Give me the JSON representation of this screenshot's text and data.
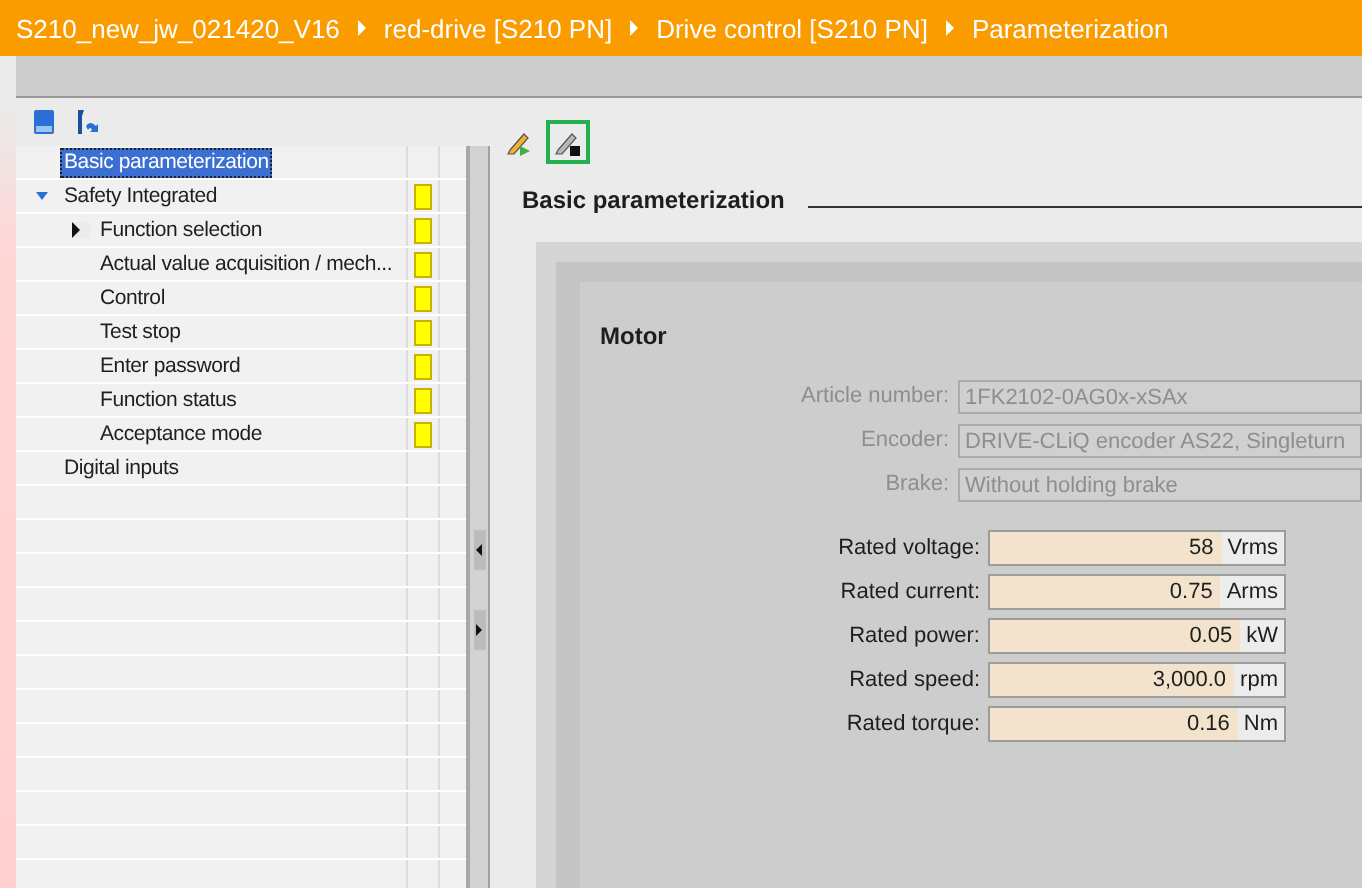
{
  "breadcrumb": [
    "S210_new_jw_021420_V16",
    "red-drive [S210 PN]",
    "Drive control [S210 PN]",
    "Parameterization"
  ],
  "tree": [
    {
      "label": "Basic parameterization",
      "selected": true
    },
    {
      "label": "Safety Integrated",
      "selected": false,
      "expanded": true,
      "color": "#ffff00",
      "children": [
        {
          "label": "Function selection",
          "selected": false,
          "expanded": false,
          "color": "#ffff00"
        },
        {
          "label": "Actual value acquisition / mech...",
          "selected": false,
          "color": "#ffff00"
        },
        {
          "label": "Control",
          "selected": false,
          "color": "#ffff00"
        },
        {
          "label": "Test stop",
          "selected": false,
          "color": "#ffff00"
        },
        {
          "label": "Enter password",
          "selected": false,
          "color": "#ffff00"
        },
        {
          "label": "Function status",
          "selected": false,
          "color": "#ffff00"
        },
        {
          "label": "Acceptance mode",
          "selected": false,
          "color": "#ffff00"
        }
      ]
    },
    {
      "label": "Digital inputs",
      "selected": false
    }
  ],
  "editor_toolbar": [
    {
      "kind": "online",
      "selected": false
    },
    {
      "kind": "offline",
      "selected": true
    }
  ],
  "section_title": "Basic parameterization",
  "motor": {
    "title": "Motor",
    "info": [
      {
        "label": "Article number:",
        "value": "1FK2102-0AG0x-xSAx",
        "disabled": true
      },
      {
        "label": "Encoder:",
        "value": "DRIVE-CLiQ encoder AS22, Singleturn",
        "disabled": true
      },
      {
        "label": "Brake:",
        "value": "Without holding brake",
        "disabled": true
      }
    ],
    "ratings": [
      {
        "label": "Rated voltage:",
        "value": "58",
        "unit": "Vrms"
      },
      {
        "label": "Rated current:",
        "value": "0.75",
        "unit": "Arms"
      },
      {
        "label": "Rated power:",
        "value": "0.05",
        "unit": "kW"
      },
      {
        "label": "Rated speed:",
        "value": "3,000.0",
        "unit": "rpm"
      },
      {
        "label": "Rated torque:",
        "value": "0.16",
        "unit": "Nm"
      }
    ]
  }
}
